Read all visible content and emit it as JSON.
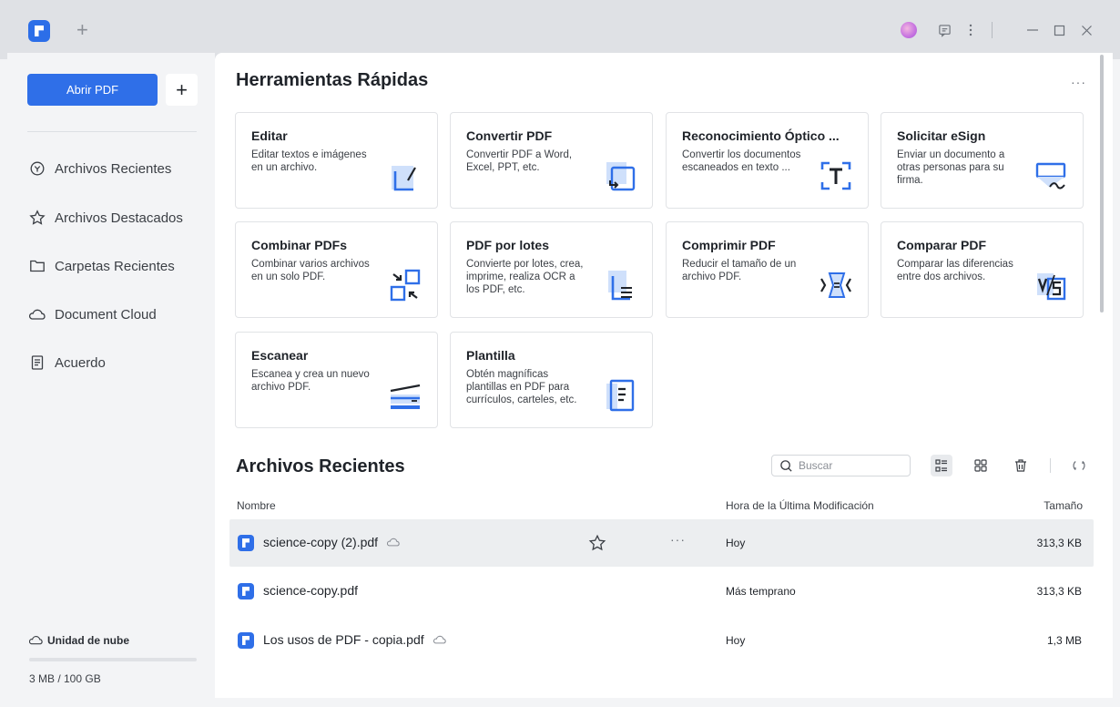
{
  "titlebar": {
    "new_tab_label": "+",
    "icons": [
      "app-logo-icon",
      "avatar",
      "feedback-icon",
      "more-vertical-icon",
      "minimize-icon",
      "maximize-icon",
      "close-icon"
    ]
  },
  "sidebar": {
    "open_button": "Abrir PDF",
    "plus_button": "+",
    "items": [
      {
        "label": "Archivos Recientes",
        "icon": "clock-icon"
      },
      {
        "label": "Archivos Destacados",
        "icon": "star-icon"
      },
      {
        "label": "Carpetas Recientes",
        "icon": "folder-icon"
      },
      {
        "label": "Document Cloud",
        "icon": "cloud-icon"
      },
      {
        "label": "Acuerdo",
        "icon": "document-icon"
      }
    ],
    "cloud": {
      "label": "Unidad de nube",
      "usage": "3 MB / 100 GB",
      "used_fraction": 3e-05
    }
  },
  "quick_tools": {
    "title": "Herramientas Rápidas",
    "more": "···",
    "cards": [
      {
        "title": "Editar",
        "desc": "Editar textos e imágenes en un archivo.",
        "icon": "edit-icon"
      },
      {
        "title": "Convertir PDF",
        "desc": "Convertir PDF a Word, Excel, PPT, etc.",
        "icon": "convert-icon"
      },
      {
        "title": "Reconocimiento Óptico ...",
        "desc": "Convertir los documentos escaneados en texto ...",
        "icon": "ocr-icon"
      },
      {
        "title": "Solicitar eSign",
        "desc": "Enviar un documento a otras personas para su firma.",
        "icon": "esign-icon"
      },
      {
        "title": "Combinar PDFs",
        "desc": "Combinar varios archivos en un solo PDF.",
        "icon": "combine-icon"
      },
      {
        "title": "PDF por lotes",
        "desc": "Convierte por lotes, crea, imprime, realiza OCR a los PDF, etc.",
        "icon": "batch-icon"
      },
      {
        "title": "Comprimir PDF",
        "desc": "Reducir el tamaño de un archivo PDF.",
        "icon": "compress-icon"
      },
      {
        "title": "Comparar PDF",
        "desc": "Comparar las diferencias entre dos archivos.",
        "icon": "compare-icon"
      },
      {
        "title": "Escanear",
        "desc": "Escanea y crea un nuevo archivo PDF.",
        "icon": "scanner-icon"
      },
      {
        "title": "Plantilla",
        "desc": "Obtén magníficas plantillas en PDF para currículos, carteles, etc.",
        "icon": "template-icon"
      }
    ]
  },
  "recent": {
    "title": "Archivos Recientes",
    "search_placeholder": "Buscar",
    "columns": {
      "name": "Nombre",
      "modified": "Hora de la Última Modificación",
      "size": "Tamaño"
    },
    "files": [
      {
        "name": "science-copy (2).pdf",
        "time": "Hoy",
        "size": "313,3 KB",
        "cloud": true,
        "highlighted": true
      },
      {
        "name": "science-copy.pdf",
        "time": "Más temprano",
        "size": "313,3 KB",
        "cloud": false,
        "highlighted": false
      },
      {
        "name": "Los usos de PDF - copia.pdf",
        "time": "Hoy",
        "size": "1,3 MB",
        "cloud": true,
        "highlighted": false
      }
    ],
    "row_more": "···"
  },
  "colors": {
    "accent": "#2f6fe8",
    "sidebar_bg": "#f3f4f6",
    "titlebar_bg": "#dfe1e5"
  }
}
